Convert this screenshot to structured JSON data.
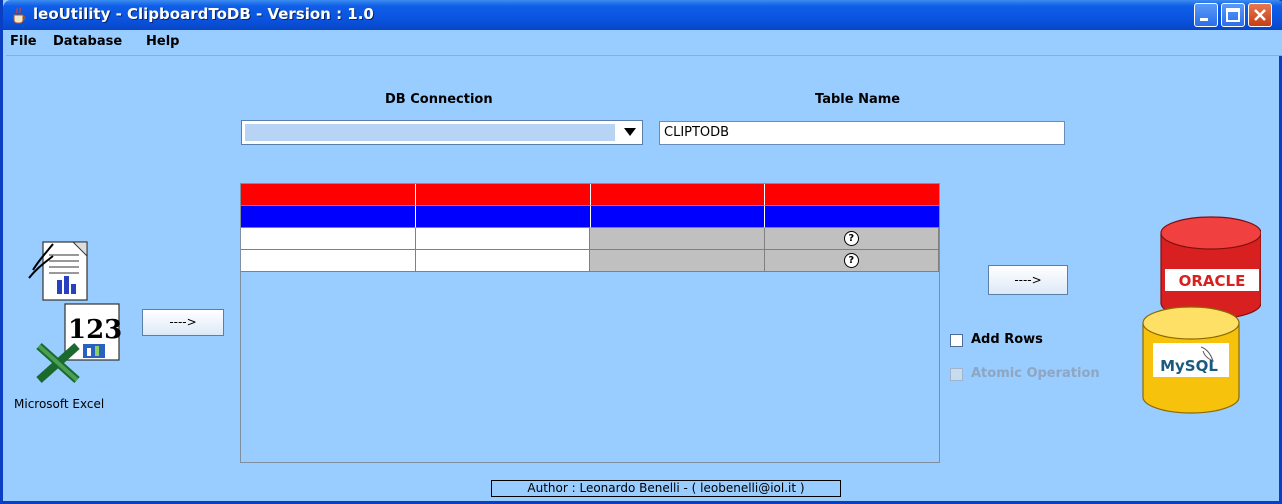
{
  "window": {
    "title": "leoUtility - ClipboardToDB - Version : 1.0"
  },
  "menu": {
    "items": [
      "File",
      "Database",
      "Help"
    ]
  },
  "labels": {
    "db_connection": "DB Connection",
    "table_name": "Table Name"
  },
  "table_name_value": "CLIPTODB",
  "excel": {
    "caption": "Microsoft Excel",
    "icon_text": "123"
  },
  "buttons": {
    "left_arrow": "---->",
    "right_arrow": "---->"
  },
  "checkboxes": {
    "add_rows": "Add Rows",
    "atomic_operation": "Atomic Operation"
  },
  "db_logos": {
    "oracle": "ORACLE",
    "mysql": "MySQL"
  },
  "footer": "Author : Leonardo Benelli - ( leobenelli@iol.it )",
  "grid": {
    "qmark": "?"
  },
  "colors": {
    "background": "#99ccff",
    "header_red": "#ff0000",
    "header_blue": "#0000ff",
    "title_blue": "#0a55e0"
  }
}
